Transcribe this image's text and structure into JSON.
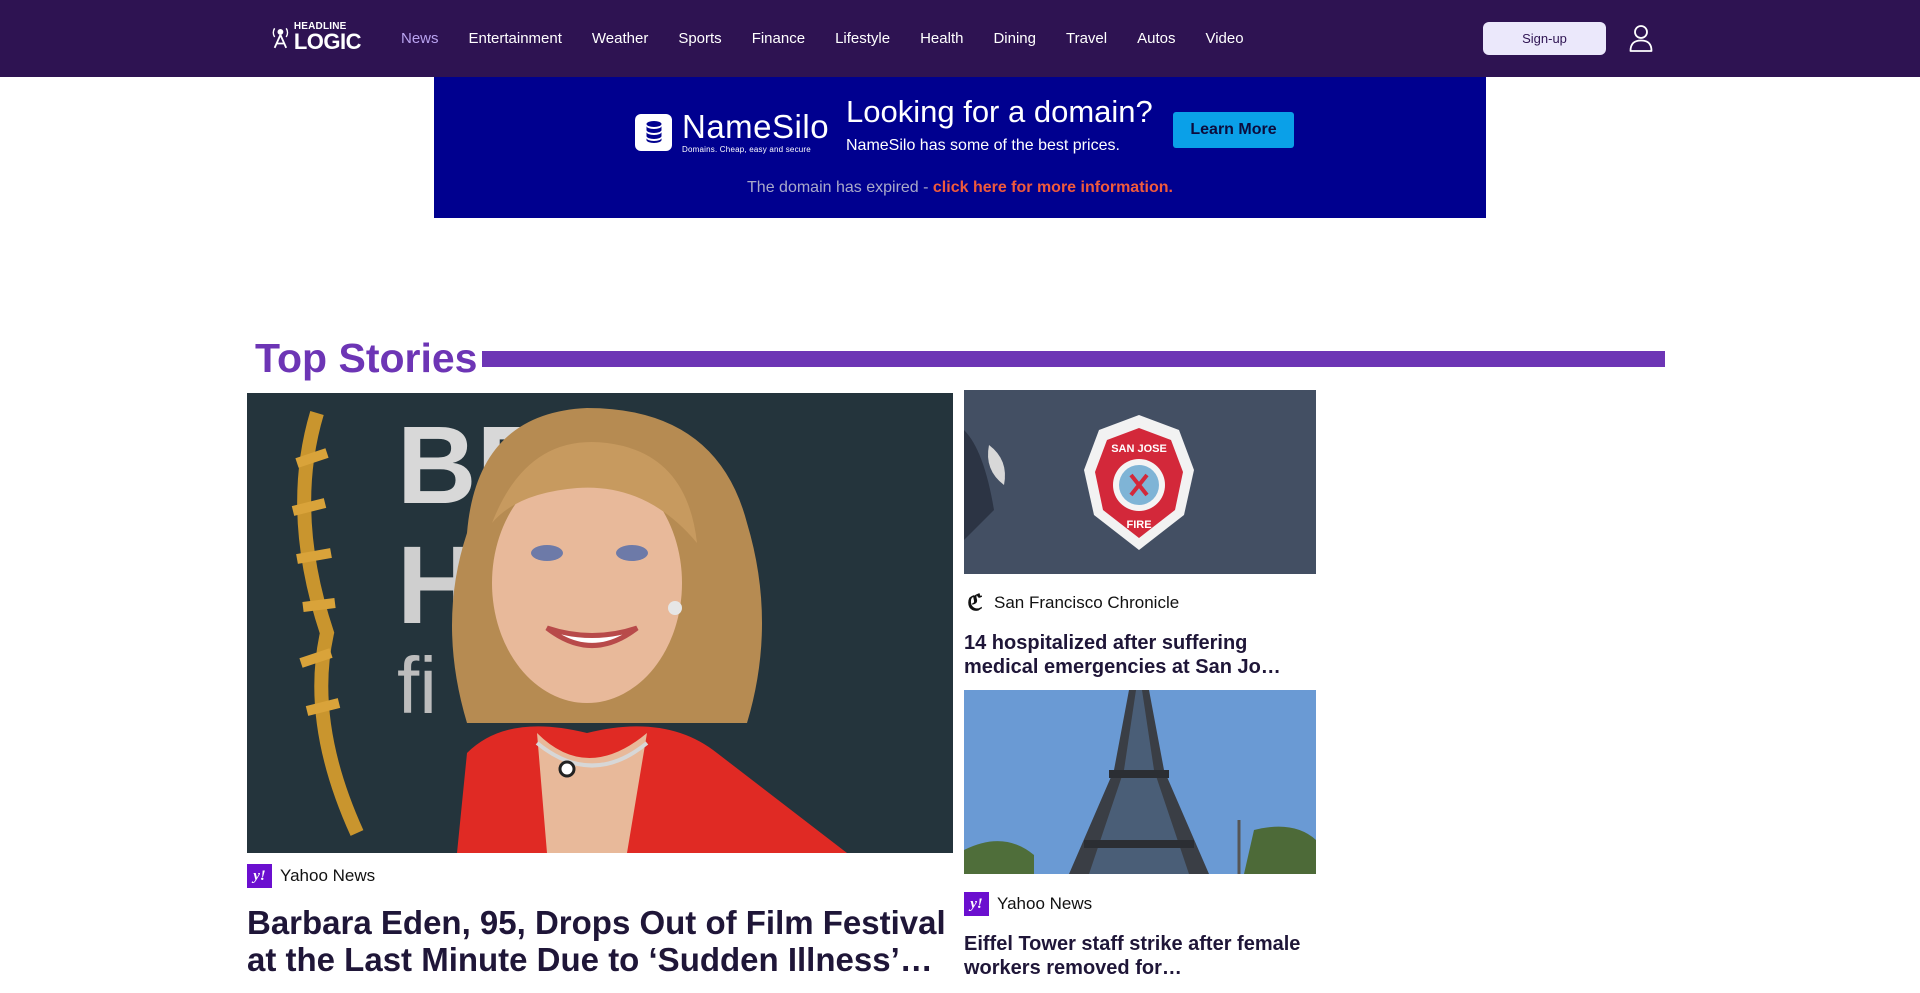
{
  "header": {
    "logo_small": "HEADLINE",
    "logo_big": "LOGIC",
    "nav": [
      {
        "label": "News",
        "active": true
      },
      {
        "label": "Entertainment"
      },
      {
        "label": "Weather"
      },
      {
        "label": "Sports"
      },
      {
        "label": "Finance"
      },
      {
        "label": "Lifestyle"
      },
      {
        "label": "Health"
      },
      {
        "label": "Dining"
      },
      {
        "label": "Travel"
      },
      {
        "label": "Autos"
      },
      {
        "label": "Video"
      }
    ],
    "signup_label": "Sign-up",
    "user_icon": "user-icon"
  },
  "ad": {
    "brand": "NameSilo",
    "tagline": "Domains. Cheap, easy and secure",
    "headline": "Looking for a domain?",
    "subtext": "NameSilo has some of the best prices.",
    "button_label": "Learn More",
    "expired_text": "The domain has expired - ",
    "expired_link": "click here for more information."
  },
  "section": {
    "title": "Top Stories"
  },
  "stories": {
    "main": {
      "source": "Yahoo News",
      "source_icon": "yahoo-icon",
      "title": "Barbara Eden, 95, Drops Out of Film Festival at the Last Minute Due to ‘Sudden Illness’…"
    },
    "side": [
      {
        "source": "San Francisco Chronicle",
        "source_icon": "chronicle-icon",
        "title": "14 hospitalized after suffering medical emergencies at San Jo…"
      },
      {
        "source": "Yahoo News",
        "source_icon": "yahoo-icon",
        "title": "Eiffel Tower staff strike after female workers removed for…"
      }
    ]
  },
  "colors": {
    "header_bg": "#2e1352",
    "nav_active": "#b9a3f0",
    "accent": "#6d35b5",
    "ad_bg": "#00008f",
    "ad_button": "#0aa0e8",
    "ad_link": "#f05a3c"
  }
}
